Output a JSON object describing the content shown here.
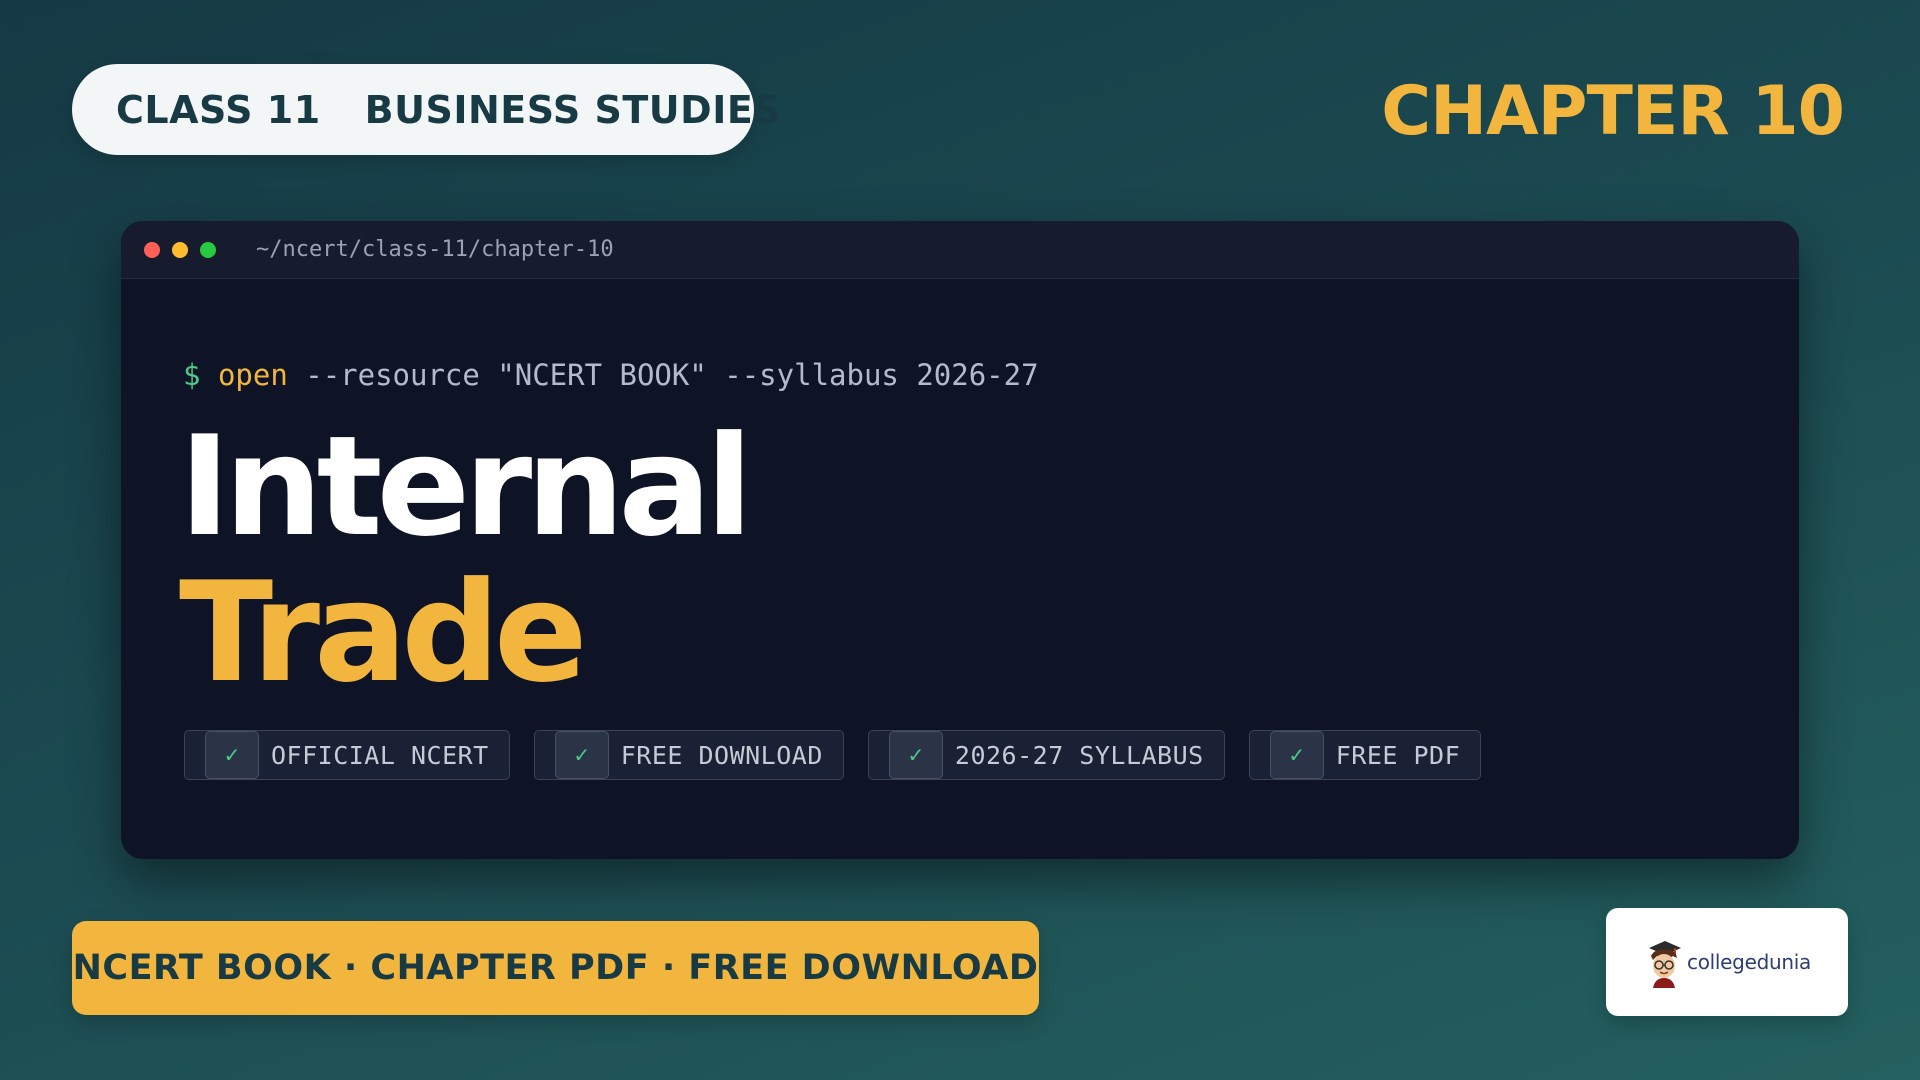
{
  "header": {
    "class_label": "CLASS 11",
    "subject_label": "BUSINESS STUDIES",
    "chapter_label": "CHAPTER 10"
  },
  "terminal": {
    "path": "~/ncert/class-11/chapter-10",
    "command": {
      "prompt": "$",
      "cmd": "open",
      "args": " --resource \"NCERT BOOK\" --syllabus 2026-27"
    },
    "title_line1": "Internal",
    "title_line2": "Trade",
    "badges": [
      {
        "label": "OFFICIAL NCERT"
      },
      {
        "label": "FREE DOWNLOAD"
      },
      {
        "label": "2026-27 SYLLABUS"
      },
      {
        "label": "FREE PDF"
      }
    ],
    "check_glyph": "✓"
  },
  "footer": {
    "banner_text": "NCERT BOOK · CHAPTER PDF · FREE DOWNLOAD",
    "logo_text": "collegedunia"
  },
  "colors": {
    "accent": "#f2b63f",
    "background": "#1c4b52",
    "terminal_bg": "#0e1325",
    "prompt_green": "#4ec98a"
  }
}
